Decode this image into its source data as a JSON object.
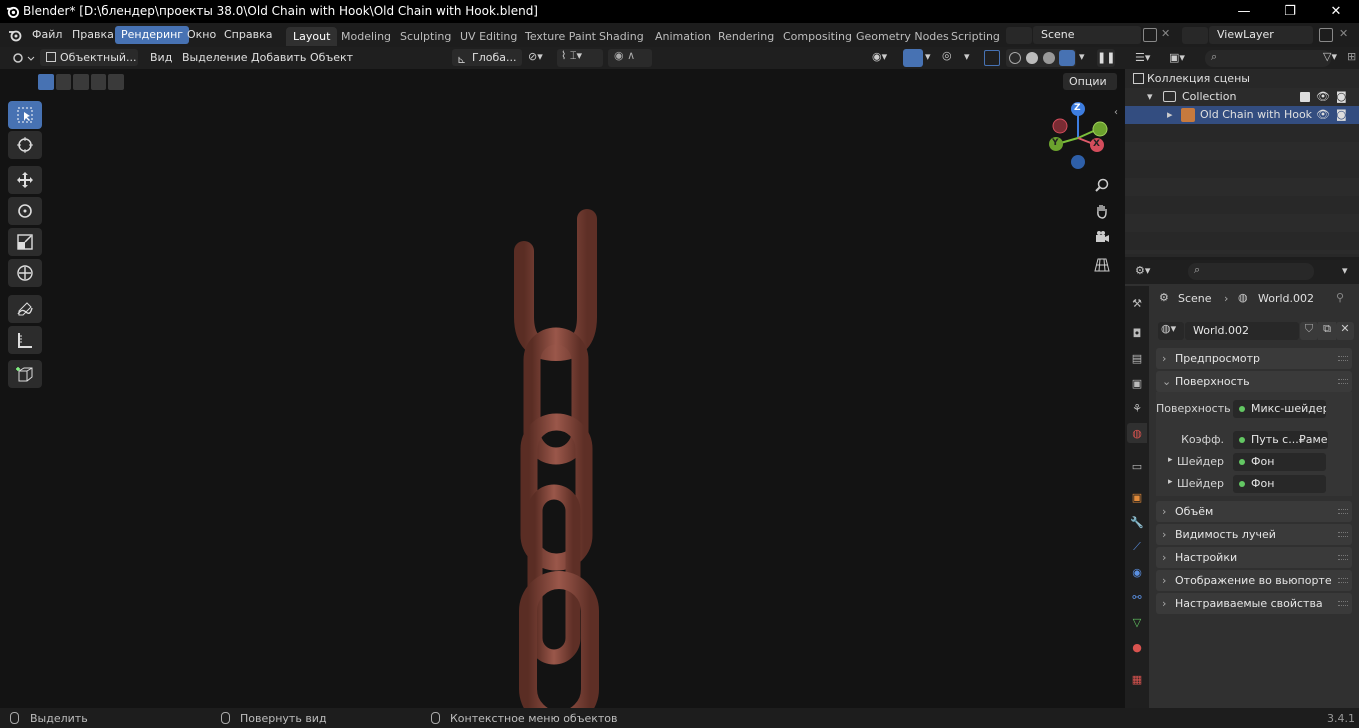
{
  "window": {
    "title": "Blender* [D:\\блендер\\проекты 38.0\\Old Chain with Hook\\Old Chain with Hook.blend]",
    "minimize": "—",
    "maximize": "❐",
    "close": "✕"
  },
  "menu": [
    "Файл",
    "Правка",
    "Рендеринг",
    "Окно",
    "Справка"
  ],
  "workspaces": [
    "Layout",
    "Modeling",
    "Sculpting",
    "UV Editing",
    "Texture Paint",
    "Shading",
    "Animation",
    "Rendering",
    "Compositing",
    "Geometry Nodes",
    "Scripting"
  ],
  "scene": {
    "name": "Scene",
    "view_layer": "ViewLayer"
  },
  "viewport_header": {
    "mode": "Объектный...",
    "menus": [
      "Вид",
      "Выделение",
      "Добавить",
      "Объект"
    ],
    "orientation": "Глоба...",
    "options": "Опции"
  },
  "outliner": {
    "scene_collection": "Коллекция сцены",
    "collection": "Collection",
    "object": "Old Chain with Hook"
  },
  "properties": {
    "breadcrumb_scene": "Scene",
    "breadcrumb_world": "World.002",
    "world_name": "World.002",
    "panels": {
      "preview": "Предпросмотр",
      "surface": "Поверхность",
      "volume": "Объём",
      "ray_visibility": "Видимость лучей",
      "settings": "Настройки",
      "viewport_display": "Отображение во вьюпорте",
      "custom_props": "Настраиваемые свойства"
    },
    "surface_label": "Поверхность",
    "surface_value": "Микс-шейдер",
    "fac_label": "Коэфф.",
    "fac_value": "Путь с...₽амеры",
    "shader1_label": "Шейдер",
    "shader1_value": "Фон",
    "shader2_label": "Шейдер",
    "shader2_value": "Фон"
  },
  "statusbar": {
    "select": "Выделить",
    "rotate": "Повернуть вид",
    "context": "Контекстное меню объектов",
    "version": "3.4.1"
  },
  "gizmo": {
    "x": "X",
    "y": "Y",
    "z": "Z"
  },
  "colors": {
    "accent": "#4772b3",
    "chain": "#8a4b3e",
    "socket": "#63c763"
  }
}
